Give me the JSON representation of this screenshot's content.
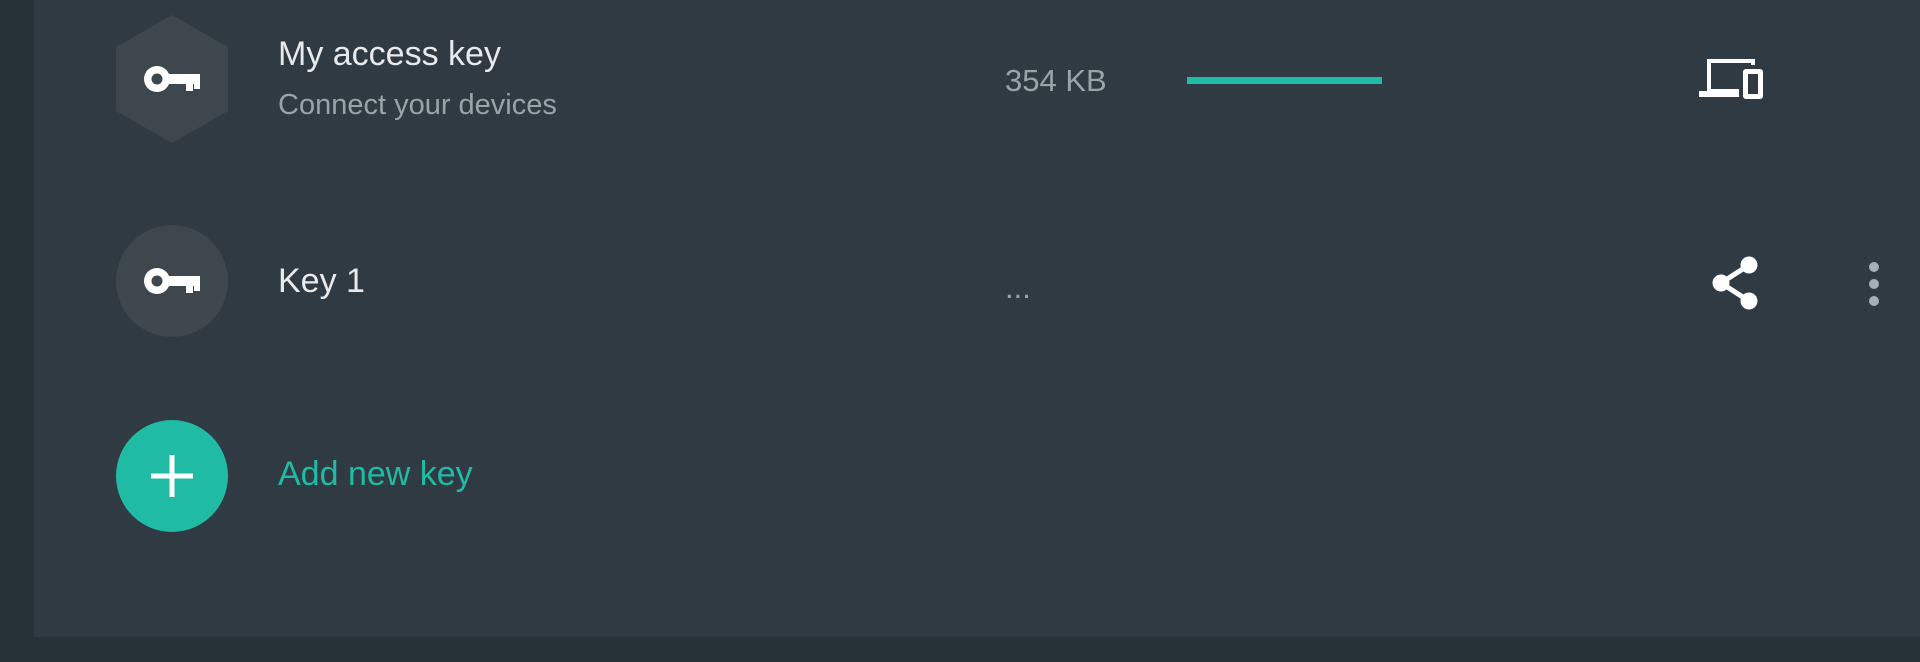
{
  "keys_list": {
    "items": [
      {
        "title": "My access key",
        "subtitle": "Connect your devices",
        "usage": "354 KB",
        "usage_fraction": 1.0,
        "action_icon": "devices-icon"
      },
      {
        "title": "Key 1",
        "usage": "...",
        "action_icon": "share-icon",
        "menu_icon": "more-vert-icon"
      }
    ],
    "add_label": "Add new key"
  },
  "colors": {
    "background": "#263238",
    "panel": "#2f3a42",
    "accent": "#1fbba4",
    "avatar": "#3d474d",
    "title_text": "#e8eaeb",
    "secondary_text": "#9aa3a8"
  }
}
